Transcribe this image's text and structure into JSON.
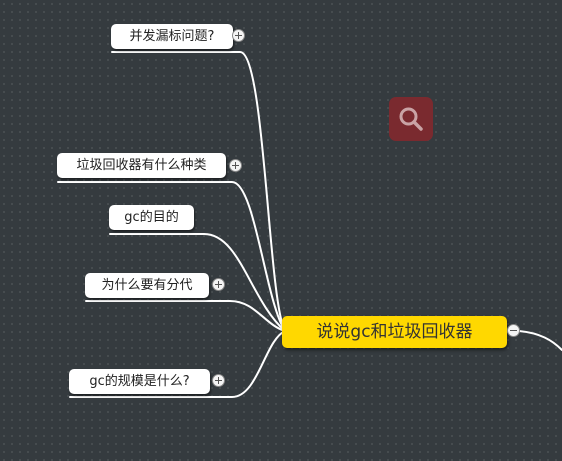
{
  "central": {
    "label": "说说gc和垃圾回收器"
  },
  "children": [
    {
      "label": "并发漏标问题?",
      "collapsed": true
    },
    {
      "label": "垃圾回收器有什么种类",
      "collapsed": true
    },
    {
      "label": "gc的目的",
      "collapsed": false
    },
    {
      "label": "为什么要有分代",
      "collapsed": true
    },
    {
      "label": "gc的规模是什么?",
      "collapsed": true
    }
  ],
  "search": {
    "icon": "search-icon"
  },
  "colors": {
    "background": "#353b3f",
    "central_fill": "#ffd800",
    "node_fill": "#ffffff",
    "connector": "#ffffff",
    "search_tile": "#7a2a2f"
  }
}
